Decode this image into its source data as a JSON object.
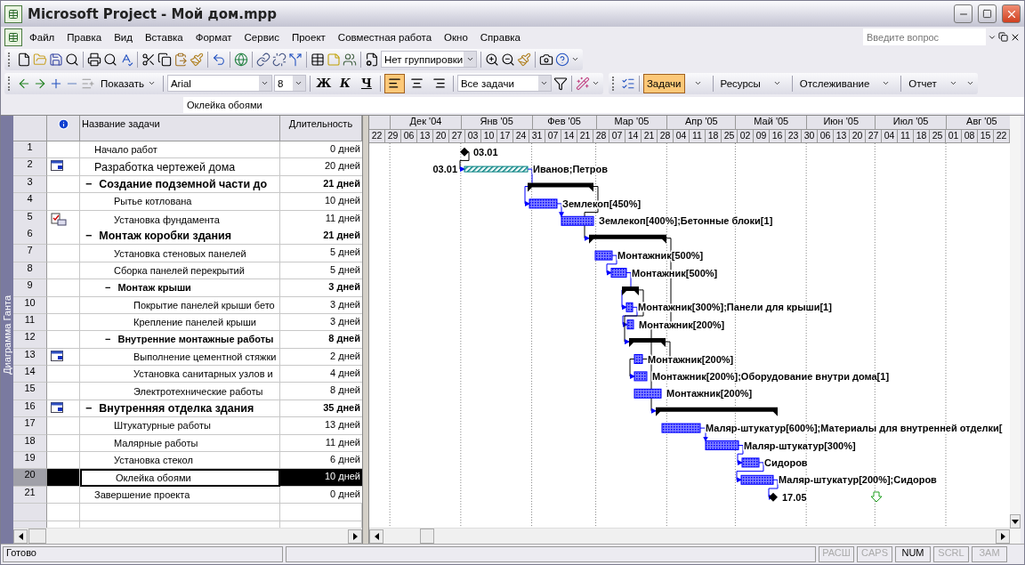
{
  "window": {
    "title": "Microsoft Project - Мой дом.mpp"
  },
  "menu": [
    "Файл",
    "Правка",
    "Вид",
    "Вставка",
    "Формат",
    "Сервис",
    "Проект",
    "Совместная работа",
    "Окно",
    "Справка"
  ],
  "help_box": {
    "placeholder": "Введите вопрос"
  },
  "standard_toolbar": {
    "grouping": "Нет группировки"
  },
  "formatting_toolbar": {
    "show": "Показать",
    "font": "Arial",
    "size": "8",
    "bold": "Ж",
    "italic": "К",
    "underline": "Ч",
    "filter": "Все задачи",
    "alignment": [
      {
        "selected": true
      },
      {
        "selected": false
      },
      {
        "selected": false
      }
    ]
  },
  "guide_toolbar": [
    {
      "label": "Задачи",
      "selected": true
    },
    {
      "label": "Ресурсы",
      "selected": false
    },
    {
      "label": "Отслеживание",
      "selected": false
    },
    {
      "label": "Отчет",
      "selected": false
    }
  ],
  "entry_bar": {
    "value": "Оклейка обоями"
  },
  "view_bar": {
    "label": "Диаграмма Ганта"
  },
  "table": {
    "columns": [
      "Название задачи",
      "Длительность"
    ],
    "tasks": [
      {
        "id": "1",
        "name": "Начало работ",
        "duration": "0 дней",
        "kind": "milestone",
        "bar_label": "03.01",
        "selected": false
      },
      {
        "id": "2",
        "name": "Разработка чертежей дома",
        "duration": "20 дней",
        "kind": "hatched",
        "calendar": true,
        "large": true,
        "start_label": "03.01",
        "bar_label": "Иванов;Петров",
        "selected": false
      },
      {
        "id": "3",
        "name": "Создание подземной части до",
        "duration": "21 дней",
        "kind": "summary",
        "outline": "−",
        "large": true,
        "selected": false,
        "children": [
          {
            "id": "4",
            "name": "Рытье котлована",
            "duration": "10 дней",
            "kind": "task",
            "bar_label": "Землекоп[450%]",
            "selected": false
          },
          {
            "id": "5",
            "name": "Установка фундамента",
            "duration": "11 дней",
            "kind": "task",
            "note": true,
            "bar_label": "Землекоп[400%];Бетонные блоки[1]",
            "selected": false
          }
        ]
      },
      {
        "id": "6",
        "name": "Монтаж коробки здания",
        "duration": "21 дней",
        "kind": "summary",
        "outline": "−",
        "large": true,
        "selected": false,
        "children": [
          {
            "id": "7",
            "name": "Установка стеновых панелей",
            "duration": "5 дней",
            "kind": "task",
            "bar_label": "Монтажник[500%]",
            "selected": false
          },
          {
            "id": "8",
            "name": "Сборка панелей перекрытий",
            "duration": "5 дней",
            "kind": "task",
            "bar_label": "Монтажник[500%]",
            "selected": false
          },
          {
            "id": "9",
            "name": "Монтаж крыши",
            "duration": "3 дней",
            "kind": "summary",
            "outline": "−",
            "selected": false,
            "children": [
              {
                "id": "10",
                "name": "Покрытие панелей крыши бето",
                "duration": "3 дней",
                "kind": "task",
                "bar_label": "Монтажник[300%];Панели для крыши[1]",
                "selected": false
              },
              {
                "id": "11",
                "name": "Крепление панелей крыши",
                "duration": "3 дней",
                "kind": "task",
                "bar_label": "Монтажник[200%]",
                "selected": false
              }
            ]
          },
          {
            "id": "12",
            "name": "Внутренние монтажные работы",
            "duration": "8 дней",
            "kind": "summary",
            "outline": "−",
            "selected": false,
            "children": [
              {
                "id": "13",
                "name": "Выполнение цементной стяжки",
                "duration": "2 дней",
                "kind": "task",
                "calendar": true,
                "bar_label": "Монтажник[200%]",
                "selected": false
              },
              {
                "id": "14",
                "name": "Установка санитарных узлов и",
                "duration": "4 дней",
                "kind": "task",
                "bar_label": "Монтажник[200%];Оборудование внутри дома[1]",
                "selected": false
              },
              {
                "id": "15",
                "name": "Электротехнические работы",
                "duration": "8 дней",
                "kind": "task",
                "bar_label": "Монтажник[200%]",
                "selected": false
              }
            ]
          }
        ]
      },
      {
        "id": "16",
        "name": "Внутренняя отделка здания",
        "duration": "35 дней",
        "kind": "summary",
        "outline": "−",
        "calendar": true,
        "large": true,
        "selected": false,
        "children": [
          {
            "id": "17",
            "name": "Штукатурные работы",
            "duration": "13 дней",
            "kind": "task",
            "bar_label": "Маляр-штукатур[600%];Материалы для внутренней отделки[",
            "selected": false
          },
          {
            "id": "18",
            "name": "Малярные работы",
            "duration": "11 дней",
            "kind": "task",
            "bar_label": "Маляр-штукатур[300%]",
            "selected": false
          },
          {
            "id": "19",
            "name": "Установка стекол",
            "duration": "6 дней",
            "kind": "task",
            "bar_label": "Сидоров",
            "selected": false
          },
          {
            "id": "20",
            "name": "Оклейка обоями",
            "duration": "10 дней",
            "kind": "task",
            "bar_label": "Маляр-штукатур[200%];Сидоров",
            "selected": true
          }
        ]
      },
      {
        "id": "21",
        "name": "Завершение проекта",
        "duration": "0 дней",
        "kind": "milestone",
        "bar_label": "17.05",
        "selected": false
      }
    ]
  },
  "timescale": {
    "months": [
      "Дек '04",
      "Янв '05",
      "Фев '05",
      "Мар '05",
      "Апр '05",
      "Май '05",
      "Июн '05",
      "Июл '05",
      "Авг '05"
    ],
    "weeks": [
      "22",
      "29",
      "06",
      "13",
      "20",
      "27",
      "03",
      "10",
      "17",
      "24",
      "31",
      "07",
      "14",
      "21",
      "28",
      "07",
      "14",
      "21",
      "28",
      "04",
      "11",
      "18",
      "25",
      "02",
      "09",
      "16",
      "23",
      "30",
      "06",
      "13",
      "20",
      "27",
      "04",
      "11",
      "18",
      "25",
      "01",
      "08",
      "15",
      "22"
    ]
  },
  "status_bar": {
    "text": "Готово",
    "indicators": [
      {
        "label": "РАСШ",
        "on": false
      },
      {
        "label": "CAPS",
        "on": false
      },
      {
        "label": "NUM",
        "on": true
      },
      {
        "label": "SCRL",
        "on": false
      },
      {
        "label": "ЗАМ",
        "on": false
      }
    ]
  }
}
